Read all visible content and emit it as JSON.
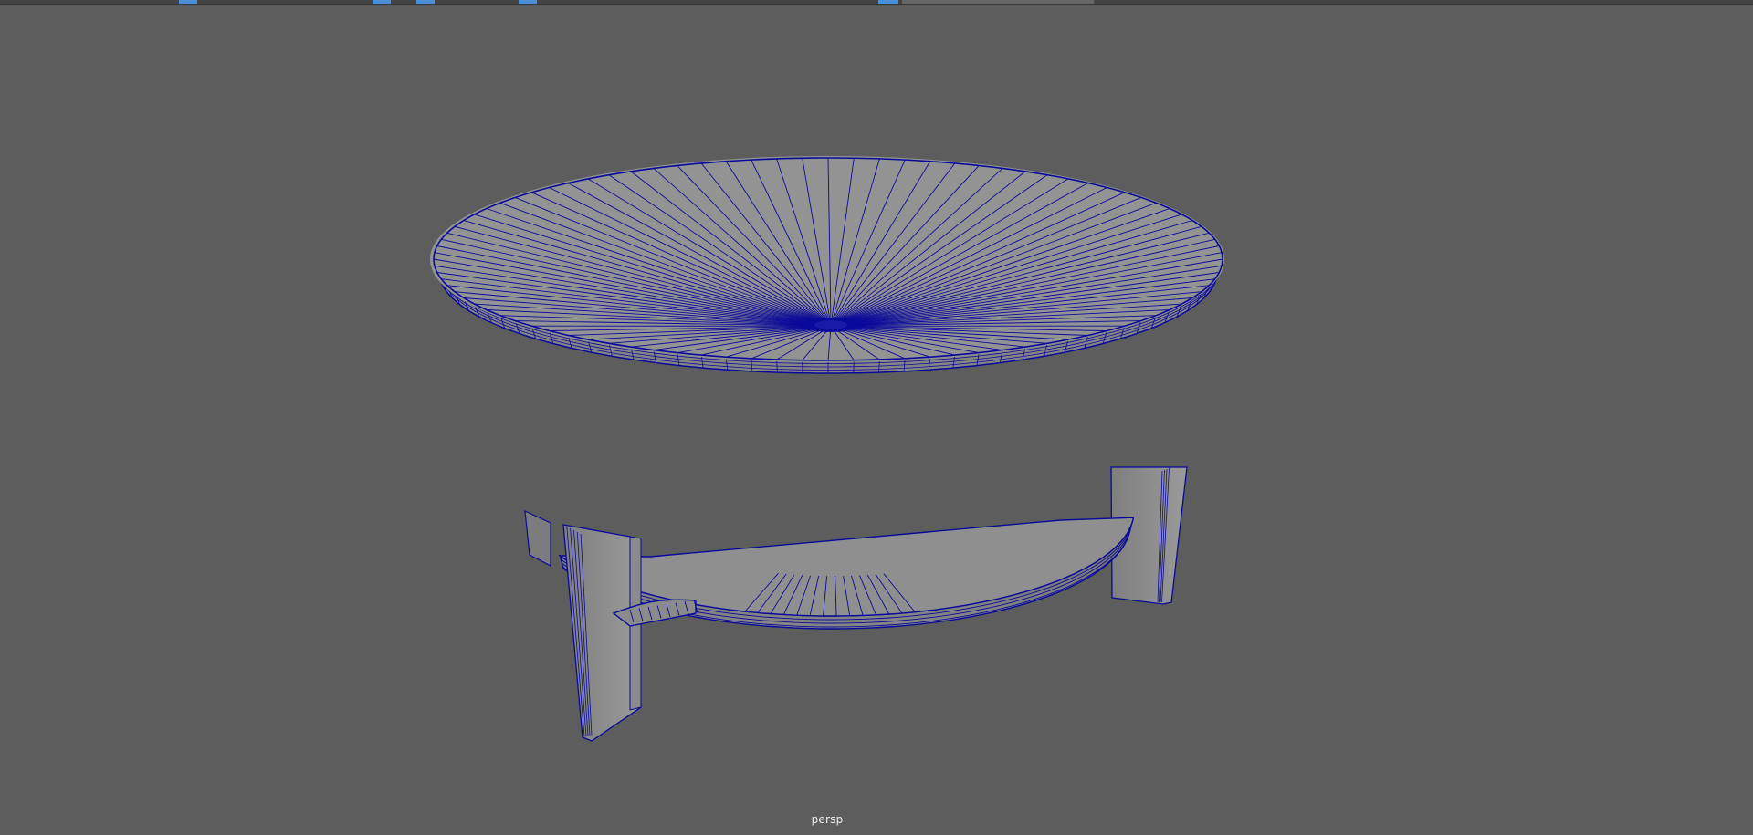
{
  "viewport": {
    "camera_name": "persp",
    "background_color": "#5d5d5d",
    "wireframe_color": "#0a0a9a",
    "shaded_color": "#8f8f8f",
    "object": "round-coffee-table-wireframe-on-shaded"
  },
  "toolbar": {
    "selected_accent": "#4a90d9"
  }
}
